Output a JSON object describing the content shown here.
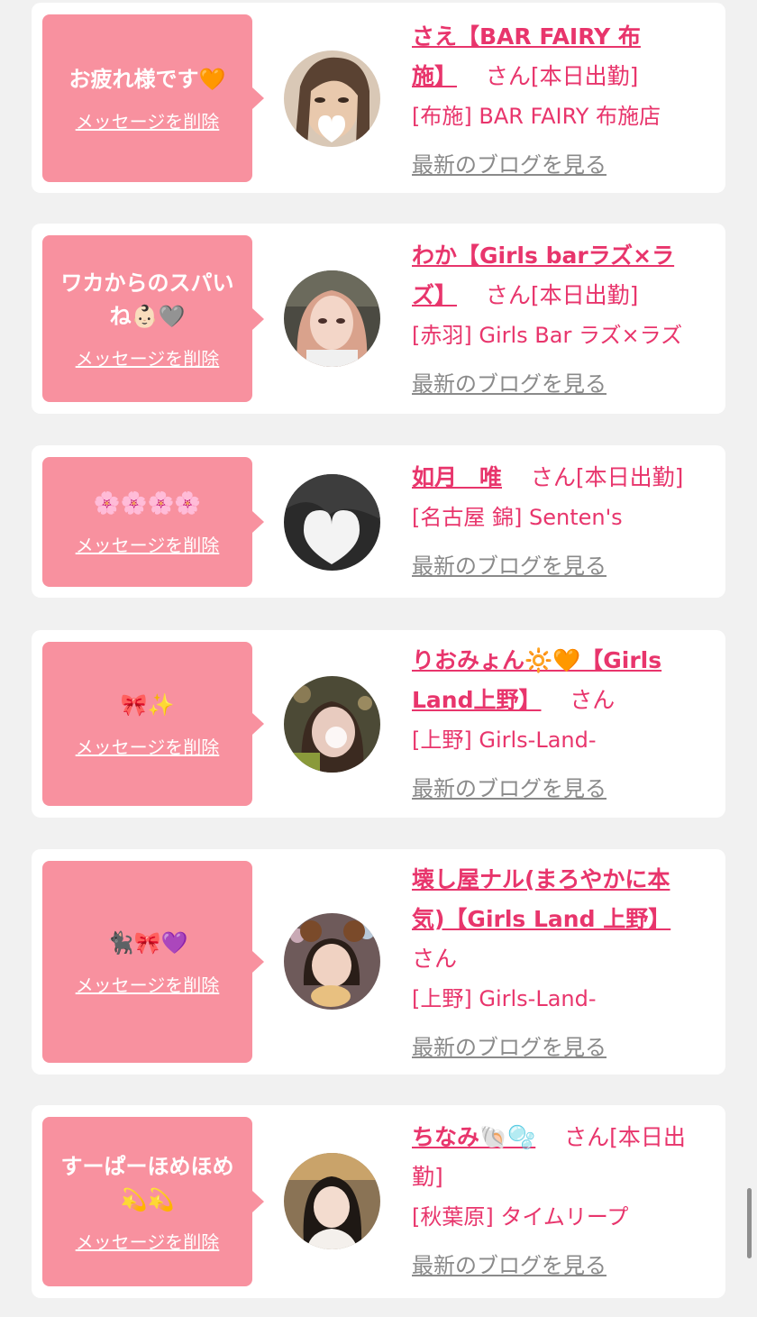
{
  "theme": {
    "accent": "#e8356c",
    "bubble": "#f8919f",
    "card": "#ffffff",
    "bg": "#f1f1f1",
    "muted": "#8a8a8a"
  },
  "common": {
    "delete_label": "メッセージを削除",
    "blog_label": "最新のブログを見る",
    "san_suffix": "さん"
  },
  "cards": [
    {
      "message_lines": [
        "お疲れ様です🧡"
      ],
      "name_lines": [
        "さえ【BAR FAIRY 布",
        "施】"
      ],
      "name_tail": "さん[本日出勤]",
      "shop": "[布施] BAR FAIRY 布施店",
      "avatar_icon": "avatar-woman-heart-sticker"
    },
    {
      "message_lines": [
        "ワカからのスパい",
        "ね👶🏻🩶"
      ],
      "name_lines": [
        "わか【Girls barラズ×ラ",
        "ズ】"
      ],
      "name_tail": "さん[本日出勤]",
      "shop": "[赤羽] Girls Bar ラズ×ラズ",
      "avatar_icon": "avatar-woman-pink-hair"
    },
    {
      "message_lines": [
        "🌸🌸🌸🌸"
      ],
      "name_lines": [
        "如月　唯"
      ],
      "name_tail": "さん[本日出勤]",
      "shop": "[名古屋 錦] Senten's",
      "avatar_icon": "avatar-heart-sticker"
    },
    {
      "message_lines": [
        "🎀✨"
      ],
      "name_lines": [
        "りおみょん🔆🧡【Girls",
        "Land上野】"
      ],
      "name_tail": "さん",
      "shop": "[上野] Girls-Land-",
      "avatar_icon": "avatar-woman-blurred"
    },
    {
      "message_lines": [
        "🐈‍⬛🎀💜"
      ],
      "name_lines": [
        "壊し屋ナル(まろやかに本",
        "気)【Girls Land 上野】"
      ],
      "name_tail": "さん",
      "shop": "[上野] Girls-Land-",
      "avatar_icon": "avatar-woman-bear-ears"
    },
    {
      "message_lines": [
        "すーぱーほめほめ",
        "💫💫"
      ],
      "name_lines": [
        "ちなみ🐚🫧"
      ],
      "name_tail": "さん[本日出",
      "name_tail2": "勤]",
      "shop": "[秋葉原] タイムリープ",
      "avatar_icon": "avatar-woman-dark-hair"
    }
  ]
}
